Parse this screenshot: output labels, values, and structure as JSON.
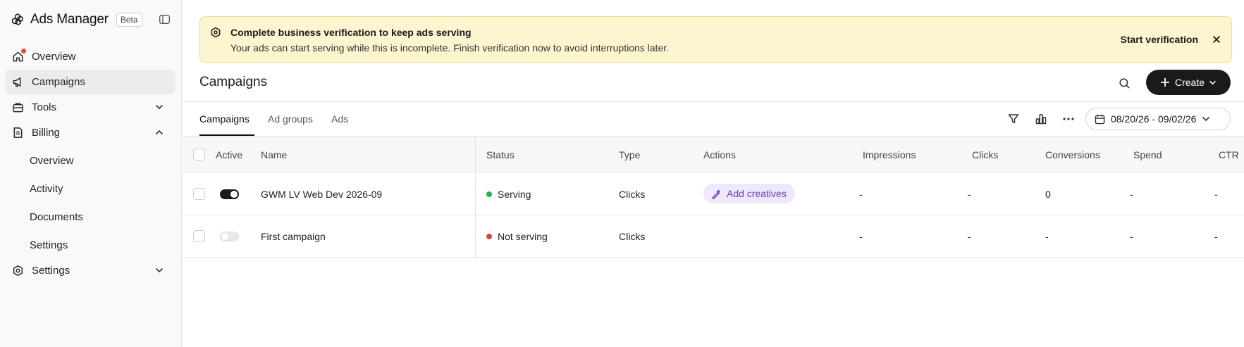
{
  "app": {
    "title": "Ads Manager",
    "badge": "Beta"
  },
  "sidebar": {
    "items": [
      {
        "label": "Overview",
        "icon": "home-icon"
      },
      {
        "label": "Campaigns",
        "icon": "megaphone-icon"
      },
      {
        "label": "Tools",
        "icon": "toolbox-icon"
      },
      {
        "label": "Billing",
        "icon": "receipt-icon"
      }
    ],
    "billing_sub": [
      "Overview",
      "Activity",
      "Documents",
      "Settings"
    ],
    "settings_label": "Settings"
  },
  "banner": {
    "title": "Complete business verification to keep ads serving",
    "text": "Your ads can start serving while this is incomplete. Finish verification now to avoid interruptions later.",
    "action": "Start verification"
  },
  "page": {
    "title": "Campaigns",
    "create_label": "Create"
  },
  "tabs": [
    "Campaigns",
    "Ad groups",
    "Ads"
  ],
  "date_range": "08/20/26 - 09/02/26",
  "table": {
    "columns": [
      "Active",
      "Name",
      "Status",
      "Type",
      "Actions",
      "Impressions",
      "Clicks",
      "Conversions",
      "Spend",
      "CTR"
    ],
    "rows": [
      {
        "active": true,
        "name": "GWM LV Web Dev 2026-09",
        "status": "Serving",
        "status_color": "#22b14c",
        "type": "Clicks",
        "action": "Add creatives",
        "impressions": "-",
        "clicks": "-",
        "conversions": "0",
        "spend": "-",
        "ctr": "-"
      },
      {
        "active": false,
        "name": "First campaign",
        "status": "Not serving",
        "status_color": "#d64545",
        "type": "Clicks",
        "action": "",
        "impressions": "-",
        "clicks": "-",
        "conversions": "-",
        "spend": "-",
        "ctr": "-"
      }
    ]
  },
  "colors": {
    "banner_bg": "#fdf5cf",
    "primary": "#1a1a1a",
    "chip_bg": "#efe7fb",
    "chip_text": "#6a3fc2"
  }
}
